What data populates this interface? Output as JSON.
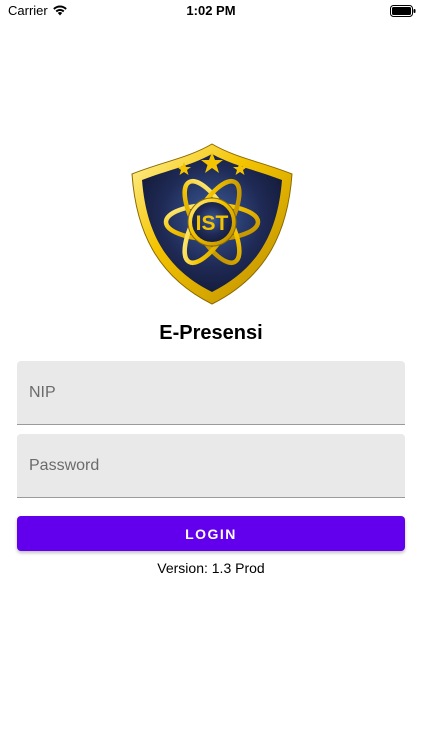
{
  "status_bar": {
    "carrier": "Carrier",
    "time": "1:02 PM",
    "wifi_icon": "wifi-icon",
    "battery_icon": "battery-icon"
  },
  "logo": {
    "text": "IST",
    "icon": "shield-atom-logo",
    "colors": {
      "shield_fill": "#1f2a55",
      "gold": "#f4c400",
      "stars": "#f4c400"
    }
  },
  "app": {
    "title": "E-Presensi"
  },
  "form": {
    "nip_placeholder": "NIP",
    "nip_value": "",
    "password_placeholder": "Password",
    "password_value": "",
    "login_label": "LOGIN"
  },
  "footer": {
    "version": "Version: 1.3 Prod"
  },
  "theme": {
    "accent": "#6200ee",
    "field_bg": "#e9e9e9"
  }
}
